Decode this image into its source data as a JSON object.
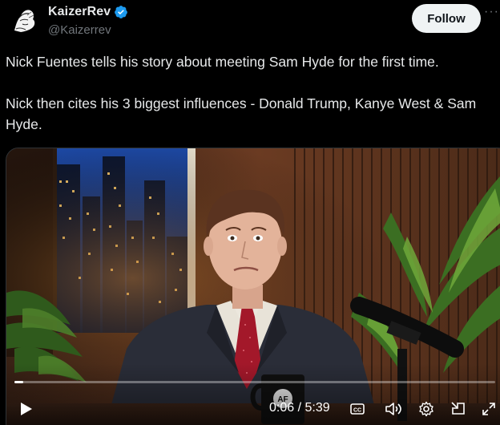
{
  "author": {
    "display_name": "KaizerRev",
    "handle": "@Kaizerrev",
    "verified": true
  },
  "follow_label": "Follow",
  "more_label": "···",
  "tweet": {
    "paragraphs": [
      "Nick Fuentes tells his story about meeting Sam Hyde for the first time.",
      "Nick then cites his 3 biggest influences - Donald Trump, Kanye West & Sam Hyde."
    ]
  },
  "video": {
    "current_time": "0:06",
    "separator": "/",
    "duration": "5:39",
    "progress_fraction": 0.018,
    "mug_logo": "AF"
  },
  "colors": {
    "background": "#000000",
    "text": "#e7e9ea",
    "secondary": "#71767b",
    "verified": "#1d9bf0",
    "follow_bg": "#eff3f4"
  },
  "icons": {
    "play": "play-icon",
    "captions": "captions-icon",
    "volume": "volume-icon",
    "settings": "gear-icon",
    "pip": "picture-in-picture-icon",
    "fullscreen": "fullscreen-icon"
  }
}
